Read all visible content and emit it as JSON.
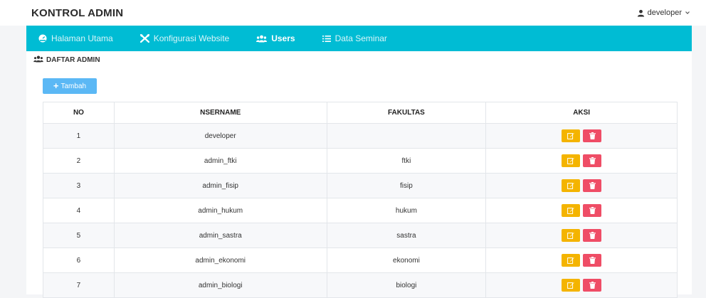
{
  "app": {
    "brand": "KONTROL ADMIN"
  },
  "user": {
    "name": "developer",
    "chevron": "⌄"
  },
  "nav": {
    "items": [
      {
        "label": "Halaman Utama",
        "icon": "dashboard-icon"
      },
      {
        "label": "Konfigurasi Website",
        "icon": "tools-icon"
      },
      {
        "label": "Users",
        "icon": "users-icon",
        "active": true
      },
      {
        "label": "Data Seminar",
        "icon": "list-icon"
      }
    ]
  },
  "panel": {
    "title": "DAFTAR ADMIN",
    "add_label": "Tambah"
  },
  "table": {
    "headers": {
      "no": "NO",
      "username": "NSERNAME",
      "fakultas": "FAKULTAS",
      "aksi": "AKSI"
    },
    "rows": [
      {
        "no": "1",
        "username": "developer",
        "fakultas": ""
      },
      {
        "no": "2",
        "username": "admin_ftki",
        "fakultas": "ftki"
      },
      {
        "no": "3",
        "username": "admin_fisip",
        "fakultas": "fisip"
      },
      {
        "no": "4",
        "username": "admin_hukum",
        "fakultas": "hukum"
      },
      {
        "no": "5",
        "username": "admin_sastra",
        "fakultas": "sastra"
      },
      {
        "no": "6",
        "username": "admin_ekonomi",
        "fakultas": "ekonomi"
      },
      {
        "no": "7",
        "username": "admin_biologi",
        "fakultas": "biologi"
      }
    ]
  },
  "colors": {
    "navbar": "#00bcd4",
    "add_button": "#5bb8f5",
    "edit_button": "#f4b400",
    "delete_button": "#ef4d66"
  }
}
